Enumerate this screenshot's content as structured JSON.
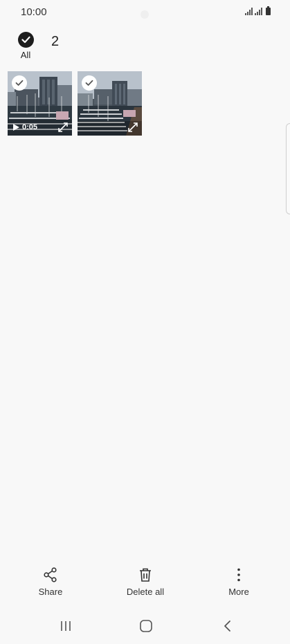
{
  "status_bar": {
    "time": "10:00"
  },
  "selection": {
    "all_label": "All",
    "count": "2"
  },
  "thumbnails": [
    {
      "type": "video",
      "duration": "0:05"
    },
    {
      "type": "image"
    }
  ],
  "actions": {
    "share": "Share",
    "delete_all": "Delete all",
    "more": "More"
  },
  "icons": {
    "select_all": "check-circle-icon",
    "thumb_check": "check-icon",
    "play": "play-icon",
    "expand": "expand-icon",
    "share": "share-icon",
    "delete": "trash-icon",
    "more": "more-vertical-icon",
    "nav_recent": "recent-apps-icon",
    "nav_home": "home-icon",
    "nav_back": "back-icon"
  },
  "colors": {
    "background": "#f8f8f8",
    "check_fill": "#1d1d1d"
  }
}
